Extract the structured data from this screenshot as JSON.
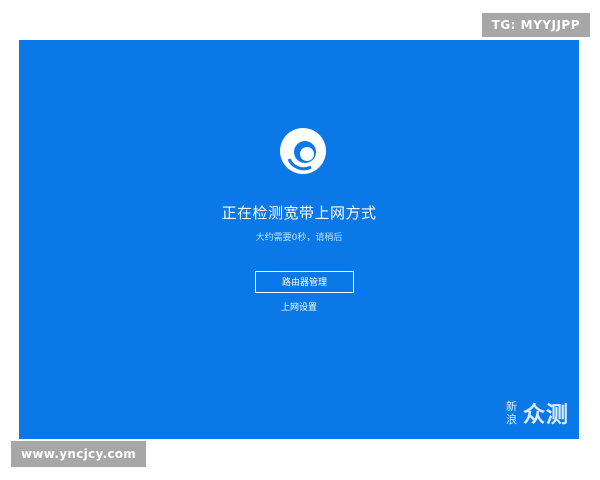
{
  "screen": {
    "bg_color": "#0a78e6",
    "loader_icon": "spinner-icon",
    "headline": "正在检测宽带上网方式",
    "subline": "大约需要0秒，请稍后",
    "router_button_label": "路由器管理",
    "network_settings_link": "上网设置"
  },
  "watermarks": {
    "brand_small_1": "新",
    "brand_small_2": "浪",
    "brand_big": "众测",
    "top_tag": "TG: MYYJJPP",
    "bottom_tag": "www.yncjcy.com"
  }
}
